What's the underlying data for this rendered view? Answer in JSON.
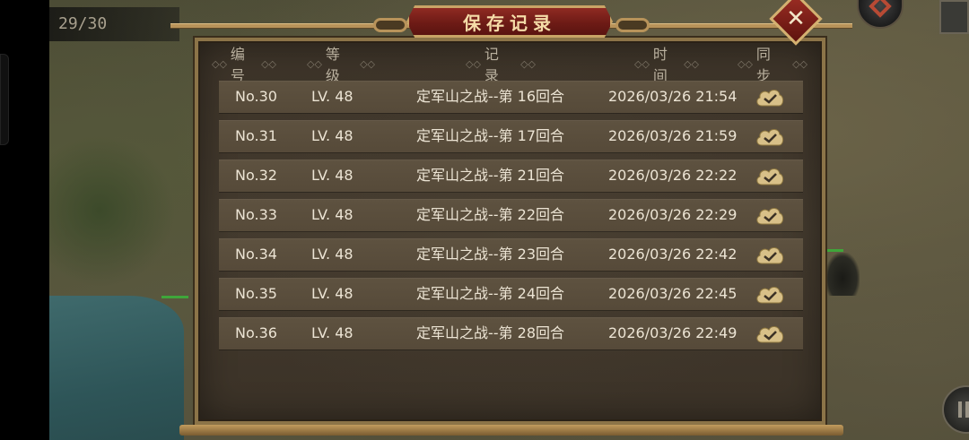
{
  "hud": {
    "save_counter": "29/30"
  },
  "dialog": {
    "title": "保存记录",
    "close_icon": "close-icon",
    "headers": [
      "编 号",
      "等 级",
      "记 录",
      "时 间",
      "同 步"
    ],
    "header_ornament": "◇◇"
  },
  "rows": [
    {
      "no": "No.30",
      "level": "LV. 48",
      "record": "定军山之战--第 16回合",
      "time": "2026/03/26 21:54",
      "sync_icon": "cloud-check-icon"
    },
    {
      "no": "No.31",
      "level": "LV. 48",
      "record": "定军山之战--第 17回合",
      "time": "2026/03/26 21:59",
      "sync_icon": "cloud-check-icon"
    },
    {
      "no": "No.32",
      "level": "LV. 48",
      "record": "定军山之战--第 21回合",
      "time": "2026/03/26 22:22",
      "sync_icon": "cloud-check-icon"
    },
    {
      "no": "No.33",
      "level": "LV. 48",
      "record": "定军山之战--第 22回合",
      "time": "2026/03/26 22:29",
      "sync_icon": "cloud-check-icon"
    },
    {
      "no": "No.34",
      "level": "LV. 48",
      "record": "定军山之战--第 23回合",
      "time": "2026/03/26 22:42",
      "sync_icon": "cloud-check-icon"
    },
    {
      "no": "No.35",
      "level": "LV. 48",
      "record": "定军山之战--第 24回合",
      "time": "2026/03/26 22:45",
      "sync_icon": "cloud-check-icon"
    },
    {
      "no": "No.36",
      "level": "LV. 48",
      "record": "定军山之战--第 28回合",
      "time": "2026/03/26 22:49",
      "sync_icon": "cloud-check-icon"
    }
  ],
  "colors": {
    "row_bg": "#5a4e3c",
    "title_banner": "#7a1f18",
    "frame_gold": "#b8935a",
    "cloud_icon": "#d8c088"
  }
}
